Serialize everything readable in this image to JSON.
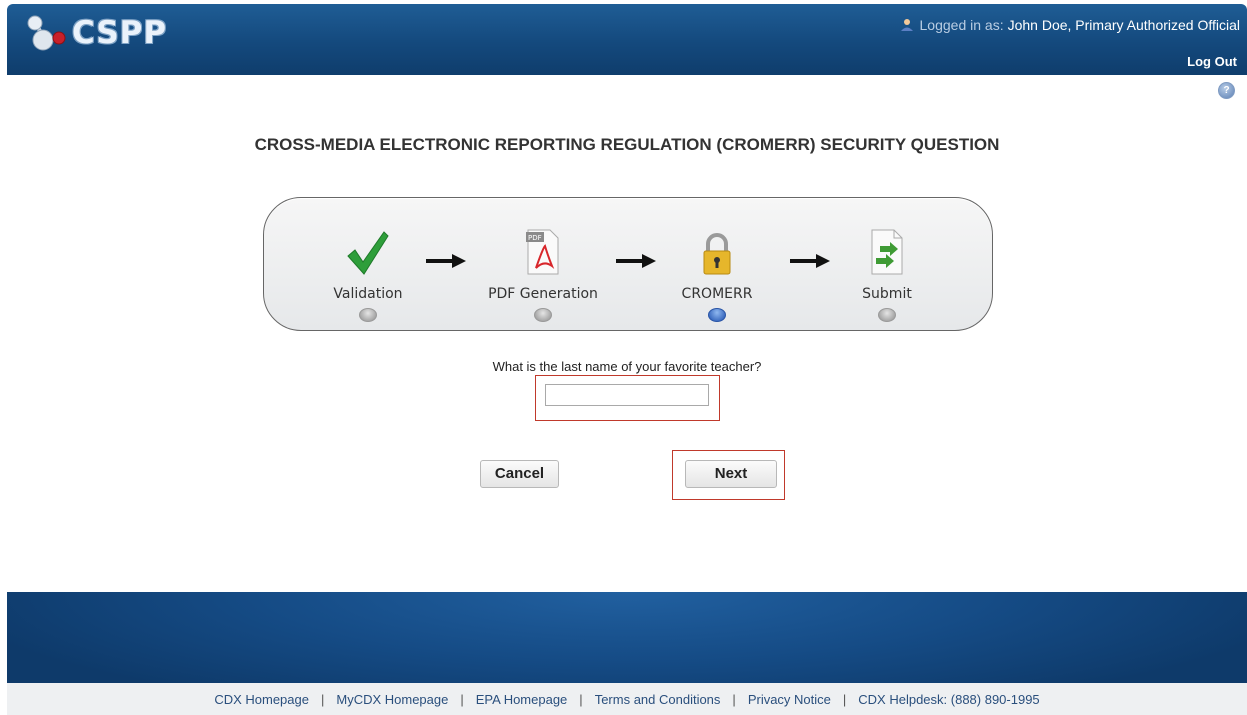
{
  "header": {
    "logo_text": "CSPP",
    "logged_in_label": "Logged in as:",
    "user_name": "John Doe, Primary Authorized Official",
    "logout_label": "Log Out"
  },
  "help": {
    "icon": "help-icon",
    "glyph": "?"
  },
  "page_title": "CROSS-MEDIA ELECTRONIC REPORTING REGULATION (CROMERR) SECURITY QUESTION",
  "progress": {
    "steps": [
      {
        "label": "Validation",
        "icon": "checkmark-icon",
        "active": false
      },
      {
        "label": "PDF Generation",
        "icon": "pdf-icon",
        "active": false
      },
      {
        "label": "CROMERR",
        "icon": "lock-icon",
        "active": true
      },
      {
        "label": "Submit",
        "icon": "submit-document-icon",
        "active": false
      }
    ],
    "active_color": "#1d4fae"
  },
  "form": {
    "question": "What is the last name of your favorite teacher?",
    "answer_value": "",
    "cancel_label": "Cancel",
    "next_label": "Next"
  },
  "footer": {
    "links": [
      "CDX Homepage",
      "MyCDX Homepage",
      "EPA Homepage",
      "Terms and Conditions",
      "Privacy Notice",
      "CDX Helpdesk: (888) 890-1995"
    ],
    "separator": "|"
  },
  "colors": {
    "header": "#14497d",
    "highlight_border": "#c0392b",
    "link": "#2a4f7d"
  }
}
